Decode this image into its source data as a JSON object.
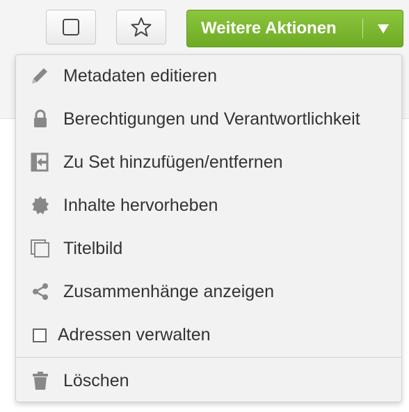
{
  "toolbar": {
    "select_icon": "checkbox-icon",
    "favorite_icon": "star-outline-icon",
    "actions_label": "Weitere Aktionen",
    "actions_caret_icon": "triangle-down-icon",
    "accent_color": "#7cb631"
  },
  "menu": {
    "items": [
      {
        "label": "Metadaten editieren",
        "icon": "pencil-icon"
      },
      {
        "label": "Berechtigungen und Verantwortlichkeit",
        "icon": "lock-icon"
      },
      {
        "label": "Zu Set hinzufügen/entfernen",
        "icon": "set-add-remove-icon"
      },
      {
        "label": "Inhalte hervorheben",
        "icon": "badge-icon"
      },
      {
        "label": "Titelbild",
        "icon": "cover-image-icon"
      },
      {
        "label": "Zusammenhänge anzeigen",
        "icon": "share-icon"
      },
      {
        "label": "Adressen verwalten",
        "icon": "checkbox-icon"
      },
      {
        "label": "Löschen",
        "icon": "trash-icon"
      }
    ]
  }
}
